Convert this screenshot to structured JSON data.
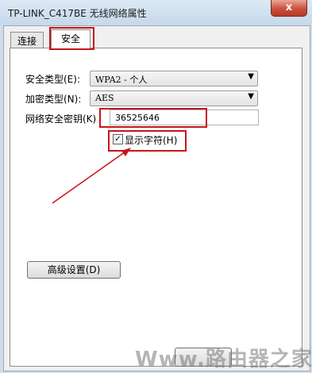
{
  "window": {
    "title": "TP-LINK_C417BE 无线网络属性",
    "close_label": "x"
  },
  "tabs": [
    {
      "label": "连接"
    },
    {
      "label": "安全"
    }
  ],
  "security": {
    "type_label": "安全类型(E):",
    "type_value": "WPA2 - 个人",
    "encryption_label": "加密类型(N):",
    "encryption_value": "AES",
    "key_label": "网络安全密钥(K)",
    "key_value": "36525646",
    "show_chars_label": "显示字符(H)",
    "show_chars_checked": true
  },
  "advanced_button": "高级设置(D)",
  "bottom_button": "确定",
  "watermark": "Www.路由器之家"
}
